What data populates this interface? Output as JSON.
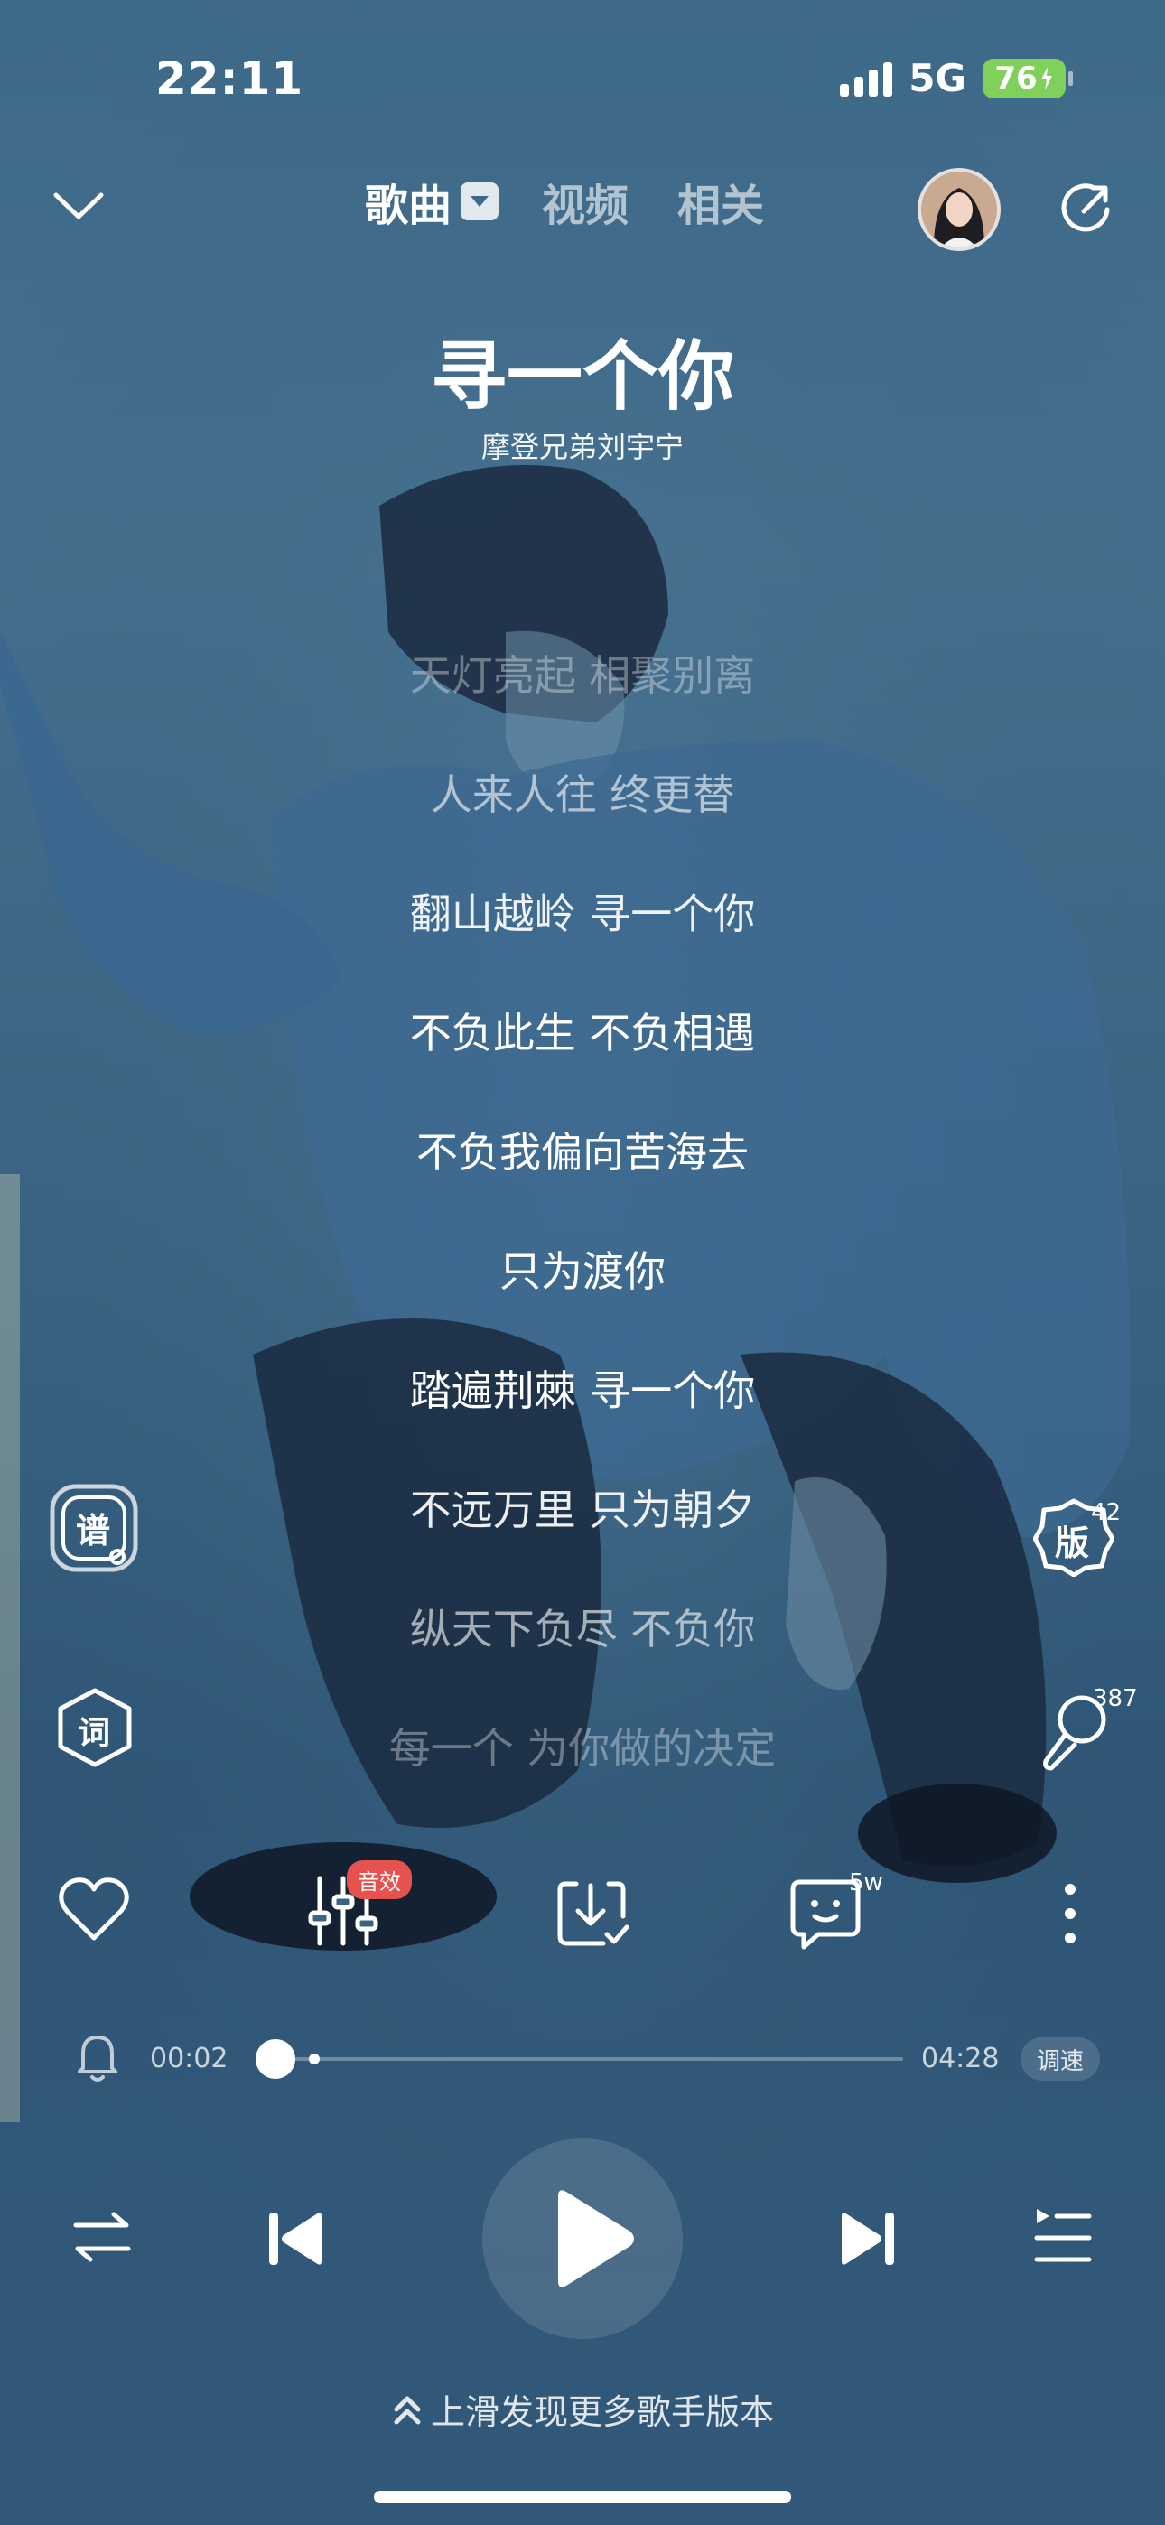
{
  "status_bar": {
    "time": "22:11",
    "network": "5G",
    "battery": "76"
  },
  "nav": {
    "tabs": [
      {
        "label": "歌曲"
      },
      {
        "label": "视频"
      },
      {
        "label": "相关"
      }
    ],
    "active_tab": "歌曲"
  },
  "song": {
    "title": "寻一个你",
    "artist": "摩登兄弟刘宇宁"
  },
  "lyrics": [
    {
      "text": "天灯亮起 相聚别离",
      "opacity": 0.35
    },
    {
      "text": "人来人往 终更替",
      "opacity": 0.6
    },
    {
      "text": "翻山越岭 寻一个你",
      "opacity": 0.92
    },
    {
      "text": "不负此生 不负相遇",
      "opacity": 1
    },
    {
      "text": "不负我偏向苦海去",
      "opacity": 1
    },
    {
      "text": "只为渡你",
      "opacity": 1
    },
    {
      "text": "踏遍荆棘 寻一个你",
      "opacity": 1
    },
    {
      "text": "不远万里 只为朝夕",
      "opacity": 0.92
    },
    {
      "text": "纵天下负尽 不负你",
      "opacity": 0.6
    },
    {
      "text": "每一个 为你做的决定",
      "opacity": 0.35
    }
  ],
  "side_buttons": {
    "sheet_label": "谱",
    "lyrics_label": "词",
    "versions_label": "版",
    "versions_count": "42",
    "comments_count": "387"
  },
  "actions": {
    "sound_effect_badge": "音效",
    "comment_count": "5w"
  },
  "progress": {
    "current": "00:02",
    "total": "04:28",
    "fraction": 0.01,
    "speed_label": "调速"
  },
  "hint": "上滑发现更多歌手版本",
  "colors": {
    "background": "#3e6a8a",
    "battery": "#7fd15c",
    "badge": "#e6534f"
  }
}
